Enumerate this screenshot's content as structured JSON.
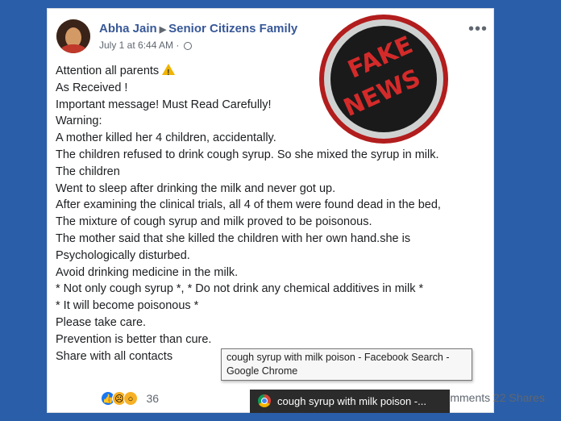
{
  "post": {
    "author_name": "Abha Jain",
    "group_name": "Senior Citizens Family",
    "timestamp": "July 1 at 6:44 AM",
    "privacy": "·",
    "more_icon": "more-options-icon",
    "lines": [
      "Attention all parents",
      "As Received !",
      "Important message! Must Read Carefully!",
      "Warning:",
      "A mother killed her 4 children, accidentally.",
      "The children refused to drink cough syrup. So she mixed the syrup in milk.",
      "The children",
      "Went to sleep after drinking the milk and never got up.",
      "After examining the clinical trials, all 4 of them were found dead in the bed,",
      "The mixture of cough syrup and milk proved to be poisonous.",
      "The mother said that she killed the children with her own hand.she is",
      "Psychologically disturbed.",
      "Avoid drinking medicine in the milk.",
      "* Not only cough syrup *, * Do not drink any chemical additives in milk *",
      "* It will become poisonous *",
      "Please take care.",
      "Prevention is better than cure.",
      "Share with all contacts"
    ]
  },
  "stamp": {
    "line1": "FAKE",
    "line2": "NEWS"
  },
  "reactions": {
    "count": "36"
  },
  "stats": {
    "text": "22 Comments  22 Shares"
  },
  "tooltip": {
    "line1": "cough syrup with milk poison - Facebook Search -",
    "line2": "Google Chrome"
  },
  "taskbar": {
    "label": "cough syrup with milk poison -..."
  },
  "colors": {
    "background": "#2a5ea8",
    "link": "#385898",
    "stamp_red": "#d42a2a"
  }
}
